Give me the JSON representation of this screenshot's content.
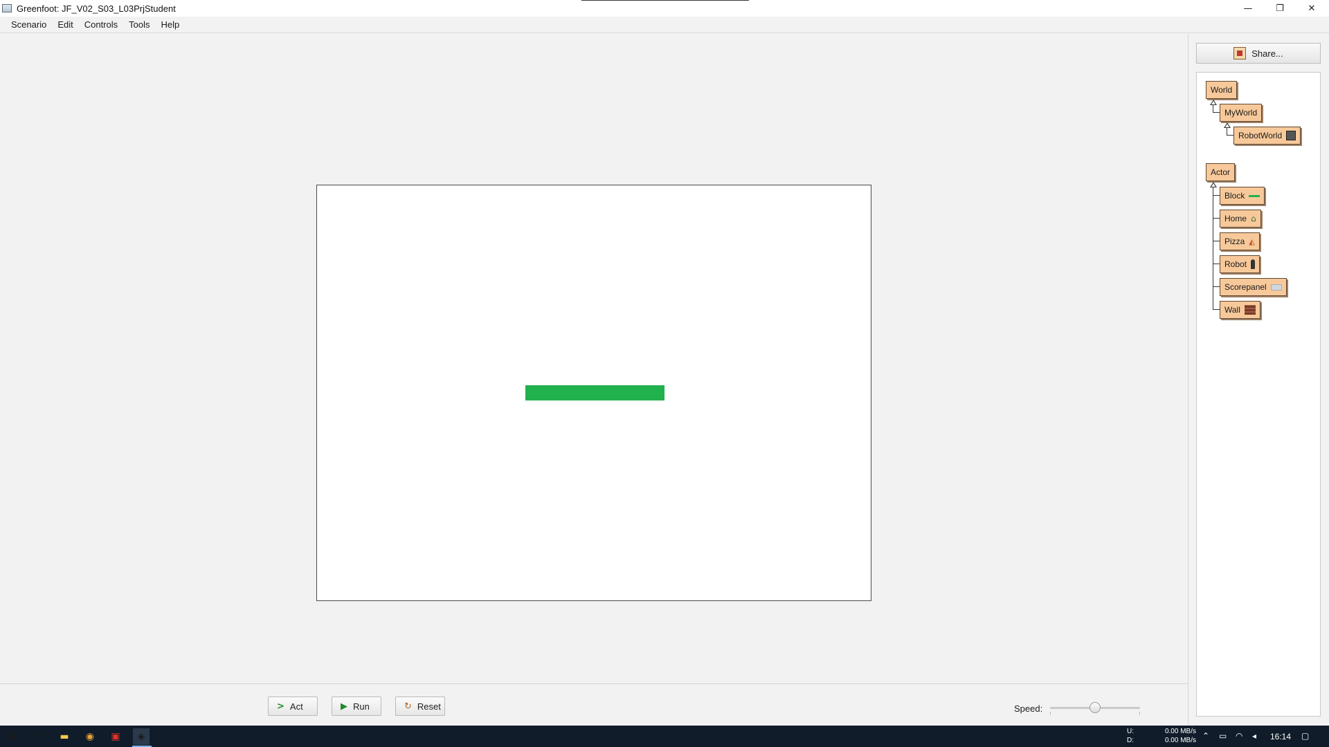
{
  "window": {
    "title": "Greenfoot: JF_V02_S03_L03PrjStudent",
    "controls": {
      "minimize": "—",
      "restore": "❐",
      "close": "✕"
    }
  },
  "menubar": {
    "items": [
      "Scenario",
      "Edit",
      "Controls",
      "Tools",
      "Help"
    ]
  },
  "world": {
    "background": "#ffffff",
    "actor_block_color": "#21b14d"
  },
  "controls": {
    "act_label": "Act",
    "run_label": "Run",
    "reset_label": "Reset",
    "act_icon": "step-arrow-icon",
    "run_icon": "play-icon",
    "reset_icon": "reset-icon",
    "speed_label": "Speed:",
    "speed_value": 0.5
  },
  "class_panel": {
    "share_label": "Share...",
    "world_classes": {
      "root": "World",
      "child": "MyWorld",
      "grandchild": "RobotWorld"
    },
    "actor_classes": {
      "root": "Actor",
      "children": [
        "Block",
        "Home",
        "Pizza",
        "Robot",
        "Scorepanel",
        "Wall"
      ]
    },
    "class_color": "#f7c99a"
  },
  "taskbar": {
    "network_up_label": "U:",
    "network_down_label": "D:",
    "network_up": "0.00 MB/s",
    "network_down": "0.00 MB/s",
    "time": "16:14",
    "background": "#101c2a"
  }
}
